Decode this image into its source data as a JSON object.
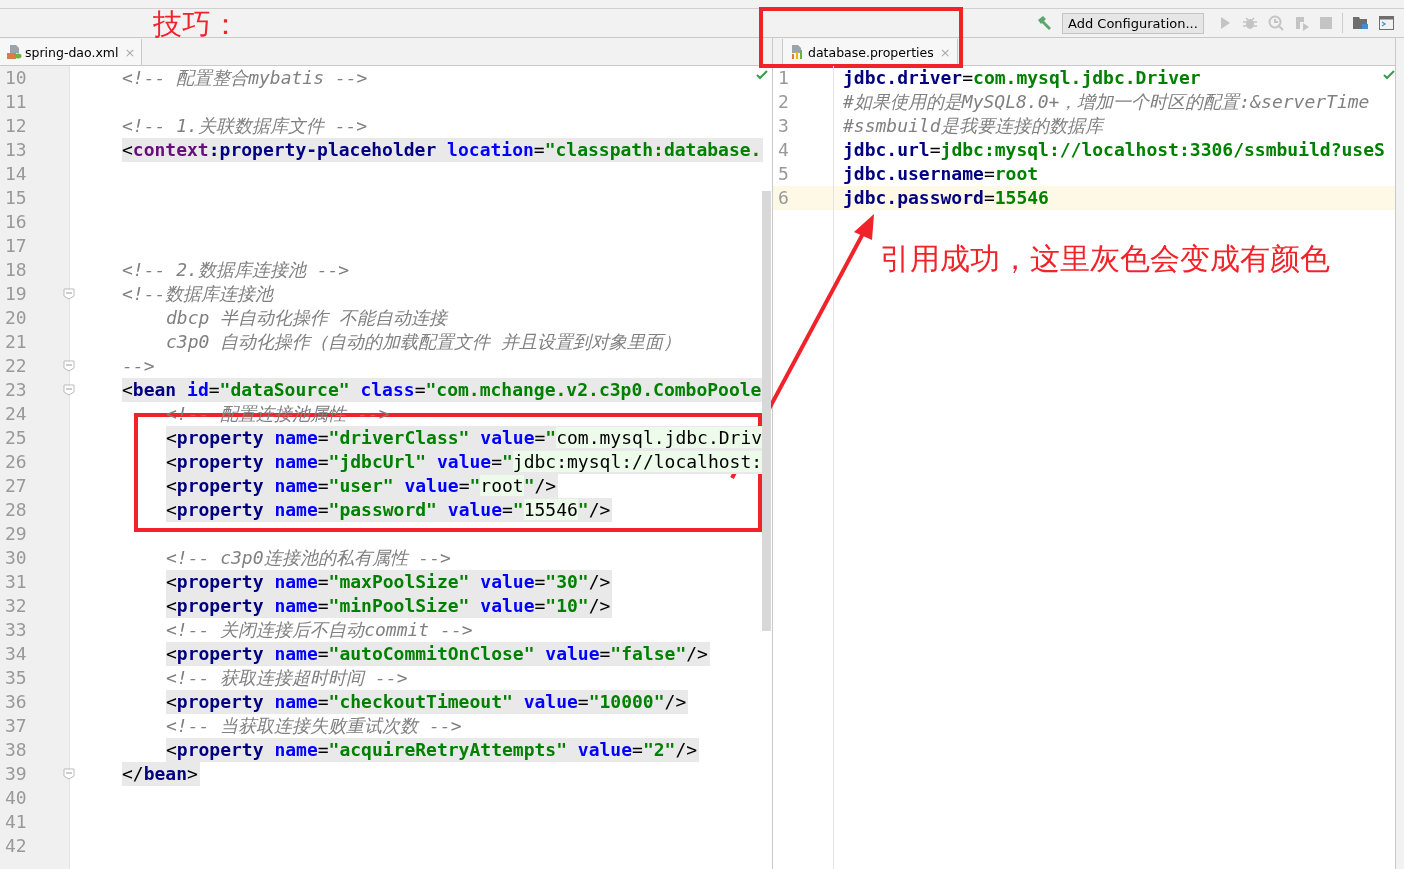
{
  "toolbar": {
    "annotation": "技巧：",
    "run_config": "Add Configuration..."
  },
  "left_editor": {
    "tab": {
      "title": "spring-dao.xml",
      "close": "×"
    },
    "lines": [
      {
        "number": "10",
        "highlighted": false,
        "fold": false,
        "segments": [
          {
            "kind": "comment",
            "text": "<!-- 配置整合mybatis -->"
          }
        ]
      },
      {
        "number": "11",
        "fold": false
      },
      {
        "number": "12",
        "highlighted": false,
        "fold": false,
        "segments": [
          {
            "kind": "comment",
            "text": "<!-- 1.关联数据库文件 -->"
          }
        ]
      },
      {
        "number": "13",
        "highlighted": true,
        "fold": false,
        "segments": [
          {
            "kind": "punct",
            "text": "<"
          },
          {
            "kind": "ns",
            "text": "context"
          },
          {
            "kind": "tag",
            "text": ":property-placeholder"
          },
          {
            "kind": "attr",
            "text": " location"
          },
          {
            "kind": "punct",
            "text": "="
          },
          {
            "kind": "value",
            "text": "\"classpath:database."
          }
        ]
      },
      {
        "number": "14",
        "fold": false
      },
      {
        "number": "15",
        "fold": false
      },
      {
        "number": "16",
        "fold": false
      },
      {
        "number": "17",
        "fold": false
      },
      {
        "number": "18",
        "highlighted": false,
        "fold": false,
        "segments": [
          {
            "kind": "comment",
            "text": "<!-- 2.数据库连接池 -->"
          }
        ]
      },
      {
        "number": "19",
        "highlighted": false,
        "fold": true,
        "segments": [
          {
            "kind": "comment",
            "text": "<!--数据库连接池"
          }
        ],
        "children": [
          {
            "number": "20",
            "highlighted": false,
            "fold": false,
            "segments": [
              {
                "kind": "comment",
                "text": "dbcp 半自动化操作 不能自动连接"
              }
            ]
          },
          {
            "number": "21",
            "highlighted": false,
            "fold": false,
            "segments": [
              {
                "kind": "comment",
                "text": "c3p0 自动化操作（自动的加载配置文件 并且设置到对象里面）"
              }
            ]
          }
        ]
      },
      {
        "number": "22",
        "highlighted": false,
        "fold": true,
        "segments": [
          {
            "kind": "comment",
            "text": "-->"
          }
        ]
      },
      {
        "number": "23",
        "highlighted": true,
        "fold": true,
        "segments": [
          {
            "kind": "punct",
            "text": "<"
          },
          {
            "kind": "tag",
            "text": "bean"
          },
          {
            "kind": "attr",
            "text": " id"
          },
          {
            "kind": "punct",
            "text": "="
          },
          {
            "kind": "value",
            "text": "\"dataSource\""
          },
          {
            "kind": "attr",
            "text": " class"
          },
          {
            "kind": "punct",
            "text": "="
          },
          {
            "kind": "value",
            "text": "\"com.mchange.v2.c3p0.ComboPoole"
          }
        ],
        "children": [
          {
            "number": "24",
            "highlighted": false,
            "fold": false,
            "segments": [
              {
                "kind": "comment",
                "text": "<!-- 配置连接池属性 -->"
              }
            ]
          },
          {
            "number": "25",
            "highlighted": true,
            "fold": false,
            "segments": [
              {
                "kind": "punct",
                "text": "<"
              },
              {
                "kind": "tag",
                "text": "property"
              },
              {
                "kind": "attr",
                "text": " name"
              },
              {
                "kind": "punct",
                "text": "="
              },
              {
                "kind": "value",
                "text": "\"driverClass\""
              },
              {
                "kind": "attr",
                "text": " value"
              },
              {
                "kind": "punct",
                "text": "="
              },
              {
                "kind": "value",
                "text": "\""
              },
              {
                "kind": "resolved",
                "text": "com.mysql.jdbc.Driv"
              }
            ]
          },
          {
            "number": "26",
            "highlighted": true,
            "fold": false,
            "segments": [
              {
                "kind": "punct",
                "text": "<"
              },
              {
                "kind": "tag",
                "text": "property"
              },
              {
                "kind": "attr",
                "text": " name"
              },
              {
                "kind": "punct",
                "text": "="
              },
              {
                "kind": "value",
                "text": "\"jdbcUrl\""
              },
              {
                "kind": "attr",
                "text": " value"
              },
              {
                "kind": "punct",
                "text": "="
              },
              {
                "kind": "value",
                "text": "\""
              },
              {
                "kind": "resolved",
                "text": "jdbc:mysql://localhost:"
              }
            ]
          },
          {
            "number": "27",
            "highlighted": true,
            "fold": false,
            "segments": [
              {
                "kind": "punct",
                "text": "<"
              },
              {
                "kind": "tag",
                "text": "property"
              },
              {
                "kind": "attr",
                "text": " name"
              },
              {
                "kind": "punct",
                "text": "="
              },
              {
                "kind": "value",
                "text": "\"user\""
              },
              {
                "kind": "attr",
                "text": " value"
              },
              {
                "kind": "punct",
                "text": "="
              },
              {
                "kind": "value",
                "text": "\""
              },
              {
                "kind": "resolved",
                "text": "root"
              },
              {
                "kind": "value",
                "text": "\""
              },
              {
                "kind": "punct",
                "text": "/>"
              }
            ]
          },
          {
            "number": "28",
            "highlighted": true,
            "fold": false,
            "segments": [
              {
                "kind": "punct",
                "text": "<"
              },
              {
                "kind": "tag",
                "text": "property"
              },
              {
                "kind": "attr",
                "text": " name"
              },
              {
                "kind": "punct",
                "text": "="
              },
              {
                "kind": "value",
                "text": "\"password\""
              },
              {
                "kind": "attr",
                "text": " value"
              },
              {
                "kind": "punct",
                "text": "="
              },
              {
                "kind": "value",
                "text": "\""
              },
              {
                "kind": "resolved",
                "text": "15546"
              },
              {
                "kind": "value",
                "text": "\""
              },
              {
                "kind": "punct",
                "text": "/>"
              }
            ]
          },
          {
            "number": "29",
            "fold": false
          },
          {
            "number": "30",
            "highlighted": false,
            "fold": false,
            "segments": [
              {
                "kind": "comment",
                "text": "<!-- c3p0连接池的私有属性 -->"
              }
            ]
          },
          {
            "number": "31",
            "highlighted": true,
            "fold": false,
            "segments": [
              {
                "kind": "punct",
                "text": "<"
              },
              {
                "kind": "tag",
                "text": "property"
              },
              {
                "kind": "attr",
                "text": " name"
              },
              {
                "kind": "punct",
                "text": "="
              },
              {
                "kind": "value",
                "text": "\"maxPoolSize\""
              },
              {
                "kind": "attr",
                "text": " value"
              },
              {
                "kind": "punct",
                "text": "="
              },
              {
                "kind": "value",
                "text": "\"30\""
              },
              {
                "kind": "punct",
                "text": "/>"
              }
            ]
          },
          {
            "number": "32",
            "highlighted": true,
            "fold": false,
            "segments": [
              {
                "kind": "punct",
                "text": "<"
              },
              {
                "kind": "tag",
                "text": "property"
              },
              {
                "kind": "attr",
                "text": " name"
              },
              {
                "kind": "punct",
                "text": "="
              },
              {
                "kind": "value",
                "text": "\"minPoolSize\""
              },
              {
                "kind": "attr",
                "text": " value"
              },
              {
                "kind": "punct",
                "text": "="
              },
              {
                "kind": "value",
                "text": "\"10\""
              },
              {
                "kind": "punct",
                "text": "/>"
              }
            ]
          },
          {
            "number": "33",
            "highlighted": false,
            "fold": false,
            "segments": [
              {
                "kind": "comment",
                "text": "<!-- 关闭连接后不自动commit -->"
              }
            ]
          },
          {
            "number": "34",
            "highlighted": true,
            "fold": false,
            "segments": [
              {
                "kind": "punct",
                "text": "<"
              },
              {
                "kind": "tag",
                "text": "property"
              },
              {
                "kind": "attr",
                "text": " name"
              },
              {
                "kind": "punct",
                "text": "="
              },
              {
                "kind": "value",
                "text": "\"autoCommitOnClose\""
              },
              {
                "kind": "attr",
                "text": " value"
              },
              {
                "kind": "punct",
                "text": "="
              },
              {
                "kind": "value",
                "text": "\"false\""
              },
              {
                "kind": "punct",
                "text": "/>"
              }
            ]
          },
          {
            "number": "35",
            "highlighted": false,
            "fold": false,
            "segments": [
              {
                "kind": "comment",
                "text": "<!-- 获取连接超时时间 -->"
              }
            ]
          },
          {
            "number": "36",
            "highlighted": true,
            "fold": false,
            "segments": [
              {
                "kind": "punct",
                "text": "<"
              },
              {
                "kind": "tag",
                "text": "property"
              },
              {
                "kind": "attr",
                "text": " name"
              },
              {
                "kind": "punct",
                "text": "="
              },
              {
                "kind": "value",
                "text": "\"checkoutTimeout\""
              },
              {
                "kind": "attr",
                "text": " value"
              },
              {
                "kind": "punct",
                "text": "="
              },
              {
                "kind": "value",
                "text": "\"10000\""
              },
              {
                "kind": "punct",
                "text": "/>"
              }
            ]
          },
          {
            "number": "37",
            "highlighted": false,
            "fold": false,
            "segments": [
              {
                "kind": "comment",
                "text": "<!-- 当获取连接失败重试次数 -->"
              }
            ]
          },
          {
            "number": "38",
            "highlighted": true,
            "fold": false,
            "segments": [
              {
                "kind": "punct",
                "text": "<"
              },
              {
                "kind": "tag",
                "text": "property"
              },
              {
                "kind": "attr",
                "text": " name"
              },
              {
                "kind": "punct",
                "text": "="
              },
              {
                "kind": "value",
                "text": "\"acquireRetryAttempts\""
              },
              {
                "kind": "attr",
                "text": " value"
              },
              {
                "kind": "punct",
                "text": "="
              },
              {
                "kind": "value",
                "text": "\"2\""
              },
              {
                "kind": "punct",
                "text": "/>"
              }
            ]
          }
        ]
      },
      {
        "number": "39",
        "highlighted": true,
        "fold": true,
        "segments": [
          {
            "kind": "punct",
            "text": "</"
          },
          {
            "kind": "tag",
            "text": "bean"
          },
          {
            "kind": "punct",
            "text": ">"
          }
        ]
      },
      {
        "number": "40",
        "fold": false
      },
      {
        "number": "41",
        "fold": false
      },
      {
        "number": "42",
        "fold": false
      }
    ]
  },
  "right_editor": {
    "tab": {
      "title": "database.properties",
      "close": "×"
    },
    "lines": [
      {
        "number": "1",
        "current": false,
        "segments": [
          {
            "kind": "key",
            "text": "jdbc.driver"
          },
          {
            "kind": "punct",
            "text": "="
          },
          {
            "kind": "value",
            "text": "com.mysql.jdbc.Driver"
          }
        ]
      },
      {
        "number": "2",
        "current": false,
        "segments": [
          {
            "kind": "comment",
            "text": "#如果使用的是MySQL8.0+，增加一个时区的配置:&serverTime"
          }
        ]
      },
      {
        "number": "3",
        "current": false,
        "segments": [
          {
            "kind": "comment",
            "text": "#ssmbuild是我要连接的数据库"
          }
        ]
      },
      {
        "number": "4",
        "current": false,
        "segments": [
          {
            "kind": "key",
            "text": "jdbc.url"
          },
          {
            "kind": "punct",
            "text": "="
          },
          {
            "kind": "value",
            "text": "jdbc:mysql://localhost:3306/ssmbuild?useS"
          }
        ]
      },
      {
        "number": "5",
        "current": false,
        "segments": [
          {
            "kind": "key",
            "text": "jdbc.username"
          },
          {
            "kind": "punct",
            "text": "="
          },
          {
            "kind": "value",
            "text": "root"
          }
        ]
      },
      {
        "number": "6",
        "current": true,
        "segments": [
          {
            "kind": "key",
            "text": "jdbc.password"
          },
          {
            "kind": "punct",
            "text": "="
          },
          {
            "kind": "value",
            "text": "15546"
          }
        ]
      }
    ]
  },
  "annotation": {
    "note": "引用成功，这里灰色会变成有颜色"
  }
}
